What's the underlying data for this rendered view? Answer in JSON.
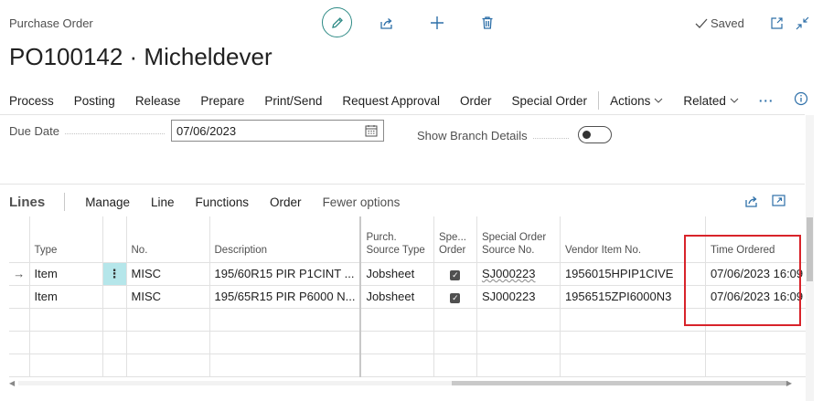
{
  "header": {
    "caption": "Purchase Order",
    "title": "PO100142 · Micheldever",
    "saved_label": "Saved"
  },
  "actions": {
    "items": [
      "Process",
      "Posting",
      "Release",
      "Prepare",
      "Print/Send",
      "Request Approval",
      "Order",
      "Special Order"
    ],
    "actions_label": "Actions",
    "related_label": "Related",
    "more_label": "···"
  },
  "fields": {
    "due_date_label": "Due Date",
    "due_date_value": "07/06/2023",
    "show_branch_label": "Show Branch Details",
    "show_branch_on": false
  },
  "lines": {
    "title": "Lines",
    "menu": [
      "Manage",
      "Line",
      "Functions",
      "Order"
    ],
    "fewer_options": "Fewer options",
    "columns": [
      "Type",
      "No.",
      "Description",
      "Purch. Source Type",
      "Spe... Order",
      "Special Order Source No.",
      "Vendor Item No.",
      "Time Ordered"
    ],
    "rows": [
      {
        "type": "Item",
        "no": "MISC",
        "description": "195/60R15 PIR P1CINT ...",
        "source_type": "Jobsheet",
        "special_order": true,
        "source_no": "SJ000223",
        "vendor_item": "1956015HPIP1CIVE",
        "time_ordered": "07/06/2023 16:09"
      },
      {
        "type": "Item",
        "no": "MISC",
        "description": "195/65R15 PIR P6000 N...",
        "source_type": "Jobsheet",
        "special_order": true,
        "source_no": "SJ000223",
        "vendor_item": "1956515ZPI6000N3",
        "time_ordered": "07/06/2023 16:09"
      }
    ]
  },
  "colors": {
    "accent": "#2d8a85",
    "highlight": "#d8232a",
    "active_cell": "#b5e6ea"
  }
}
